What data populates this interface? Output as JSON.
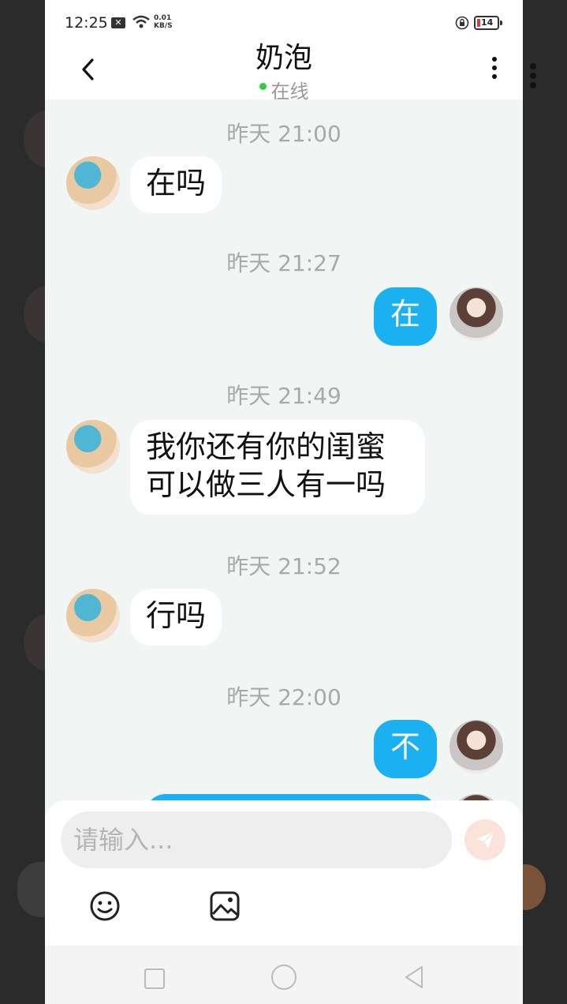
{
  "status_bar": {
    "time": "12:25",
    "net_speed_value": "0.01",
    "net_speed_unit": "KB/S",
    "battery": "14"
  },
  "header": {
    "title": "奶泡",
    "status": "在线"
  },
  "messages": [
    {
      "time": "昨天 21:00",
      "side": "in",
      "text": "在吗"
    },
    {
      "time": "昨天 21:27",
      "side": "out",
      "text": "在"
    },
    {
      "time": "昨天 21:49",
      "side": "in",
      "text": "我你还有你的闺蜜\n可以做三人有一吗"
    },
    {
      "time": "昨天 21:52",
      "side": "in",
      "text": "行吗"
    },
    {
      "time": "昨天 22:00",
      "side": "out",
      "text": "不"
    }
  ],
  "composer": {
    "placeholder": "请输入..."
  },
  "colors": {
    "accent": "#1bb0f0",
    "online": "#2ecc40",
    "send_button": "#fbe3dc"
  }
}
